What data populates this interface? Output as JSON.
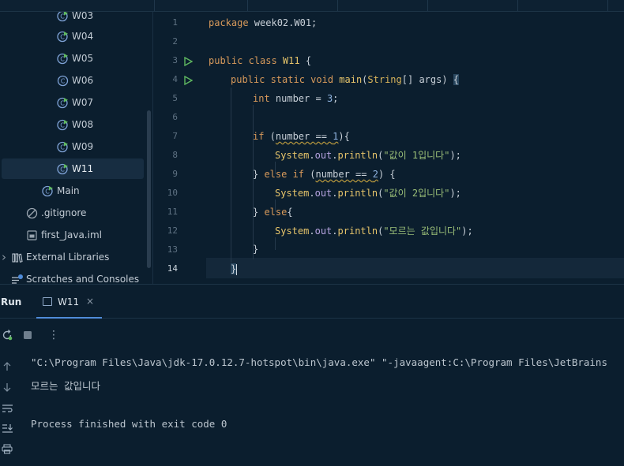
{
  "colors": {
    "background": "#0b1e2e",
    "selection": "#172d41",
    "keyword": "#d89a5b",
    "string": "#9bbf78",
    "number": "#8fb3e0",
    "run_green": "#5fb860",
    "class_icon": "#7ea2d6",
    "tab_underline": "#4f8bd8"
  },
  "tree": {
    "items": [
      {
        "label": "W03",
        "icon": "java-class-runnable-icon"
      },
      {
        "label": "W04",
        "icon": "java-class-runnable-icon"
      },
      {
        "label": "W05",
        "icon": "java-class-runnable-icon"
      },
      {
        "label": "W06",
        "icon": "java-class-icon"
      },
      {
        "label": "W07",
        "icon": "java-class-runnable-icon"
      },
      {
        "label": "W08",
        "icon": "java-class-runnable-icon"
      },
      {
        "label": "W09",
        "icon": "java-class-runnable-icon"
      },
      {
        "label": "W11",
        "icon": "java-class-runnable-icon",
        "selected": true
      },
      {
        "label": "Main",
        "icon": "java-class-runnable-icon"
      },
      {
        "label": ".gitignore",
        "icon": "ignore-file-icon"
      },
      {
        "label": "first_Java.iml",
        "icon": "module-file-icon"
      },
      {
        "label": "External Libraries",
        "icon": "library-icon"
      },
      {
        "label": "Scratches and Consoles",
        "icon": "scratches-icon"
      }
    ]
  },
  "editor": {
    "line_numbers": [
      "1",
      "2",
      "3",
      "4",
      "5",
      "6",
      "7",
      "8",
      "9",
      "10",
      "11",
      "12",
      "13",
      "14"
    ],
    "current_line": "14",
    "code": {
      "l1_kw": "package",
      "l1_rest": " week02.W01;",
      "l3_kw": "public class",
      "l3_name": " W11",
      "l3_rest": " {",
      "l4_kw": "public static void",
      "l4_fn": " main",
      "l4_p1": "(",
      "l4_type": "String",
      "l4_rest": "[] args) ",
      "l4_brace": "{",
      "l5_kw": "int",
      "l5_rest": " number = ",
      "l5_num": "3",
      "l5_end": ";",
      "l7_kw": "if",
      "l7_p": " (",
      "l7_cond": "number == ",
      "l7_num": "1",
      "l7_end": "){",
      "l8_cls": "System",
      "l8_dot": ".",
      "l8_fld": "out",
      "l8_dot2": ".",
      "l8_fn": "println",
      "l8_p": "(",
      "l8_str": "\"값이 1입니다\"",
      "l8_end": ");",
      "l9_b": "} ",
      "l9_kw": "else if",
      "l9_p": " (",
      "l9_cond": "number == ",
      "l9_num": "2",
      "l9_end": ") {",
      "l10_str": "\"값이 2입니다\"",
      "l11_b": "} ",
      "l11_kw": "else",
      "l11_end": "{",
      "l12_str": "\"모르는 값입니다\"",
      "l13": "}",
      "l14": "}"
    }
  },
  "run_panel": {
    "title": "Run",
    "tab_label": "W11",
    "tab_close": "×",
    "more_label": "⋮",
    "console": {
      "command": "\"C:\\Program Files\\Java\\jdk-17.0.12.7-hotspot\\bin\\java.exe\" \"-javaagent:C:\\Program Files\\JetBrains",
      "output": "모르는 값입니다",
      "exit": "Process finished with exit code 0"
    }
  }
}
